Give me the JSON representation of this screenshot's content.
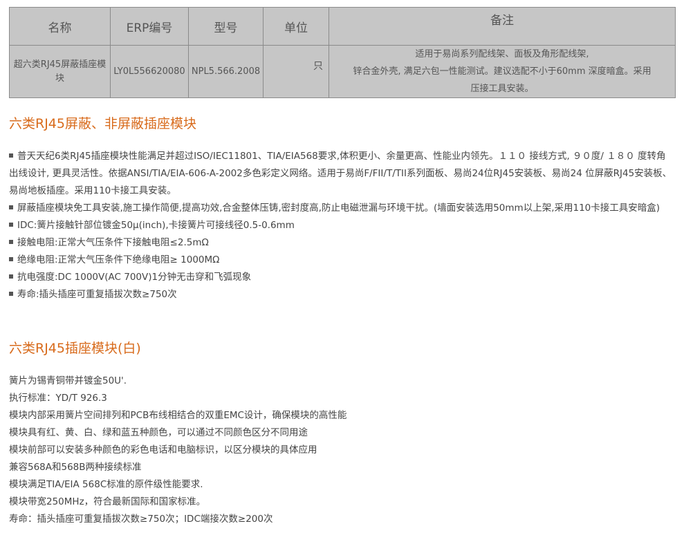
{
  "table": {
    "headers": {
      "name": "名称",
      "erp": "ERP编号",
      "model": "型号",
      "unit": "单位",
      "remark": "备注"
    },
    "row": {
      "name": "超六类RJ45屏蔽插座模块",
      "erp": "LY0L556620080",
      "model": "NPL5.566.2008",
      "unit": "只",
      "remark_lines": [
        "适用于易尚系列配线架、面板及角形配线架,",
        "锌合金外壳, 满足六包一性能测试。建议选配不小于60mm 深度暗盒。采用",
        "压接工具安装。"
      ]
    }
  },
  "section1": {
    "title": "六类RJ45屏蔽、非屏蔽插座模块",
    "items": [
      "普天天纪6类RJ45插座模块性能满足并超过ISO/IEC11801、TIA/EIA568要求,体积更小、余量更高、性能业内领先。１１０ 接线方式, ９０度/ １８０ 度转角出线设计, 更具灵活性。依据ANSI/TIA/EIA-606-A-2002多色彩定义网络。适用于易尚F/FII/T/TII系列面板、易尚24位RJ45安装板、易尚24 位屏蔽RJ45安装板、易尚地板插座。采用110卡接工具安装。",
      "屏蔽插座模块免工具安装,施工操作简便,提高功效,合金整体压铸,密封度高,防止电磁泄漏与环境干扰。(墙面安装选用50mm以上架,采用110卡接工具安暗盒)",
      "IDC:簧片接触针部位镀金50μ(inch),卡接簧片可接线径0.5-0.6mm",
      "接触电阻:正常大气压条件下接触电阻≤2.5mΩ",
      "绝缘电阻:正常大气压条件下绝缘电阻≥ 1000MΩ",
      "抗电强度:DC 1000V(AC 700V)1分钟无击穿和飞弧现象",
      "寿命:插头插座可重复插拔次数≥750次"
    ]
  },
  "section2": {
    "title": "六类RJ45插座模块(白)",
    "lines": [
      "簧片为锡青铜带并镀金50U'.",
      "执行标准：YD/T 926.3",
      "模块内部采用簧片空间排列和PCB布线相结合的双重EMC设计，确保模块的高性能",
      "模块具有红、黄、白、绿和蓝五种颜色，可以通过不同颜色区分不同用途",
      "模块前部可以安装多种颜色的彩色电话和电脑标识，以区分模块的具体应用",
      "兼容568A和568B两种接续标准",
      "模块满足TIA/EIA 568C标准的原件级性能要求.",
      "模块带宽250MHz，符合最新国际和国家标准。",
      "寿命：插头插座可重复插拔次数≥750次；IDC端接次数≥200次"
    ]
  },
  "colors": {
    "heading": "#d86b1c",
    "table_bg": "#c6c6c6"
  }
}
